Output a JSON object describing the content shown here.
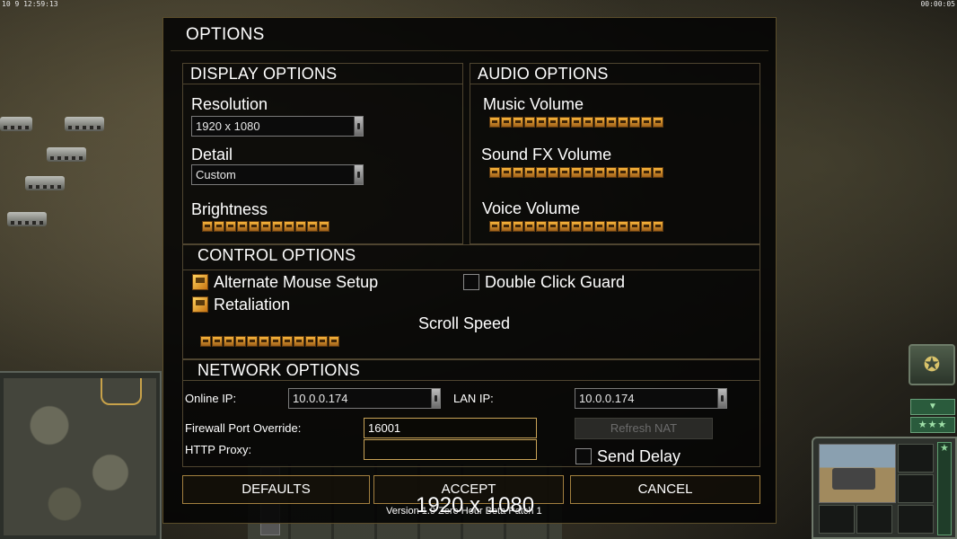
{
  "hud": {
    "top_left": "10 9 12:59:13",
    "top_right": "00:00:05"
  },
  "dialog": {
    "title": "OPTIONS",
    "display": {
      "header": "DISPLAY OPTIONS",
      "resolution_label": "Resolution",
      "resolution_value": "1920 x 1080",
      "detail_label": "Detail",
      "detail_value": "Custom",
      "brightness_label": "Brightness",
      "brightness_level": 1.0
    },
    "audio": {
      "header": "AUDIO OPTIONS",
      "music_label": "Music Volume",
      "music_level": 1.0,
      "sfx_label": "Sound FX Volume",
      "sfx_level": 1.0,
      "voice_label": "Voice Volume",
      "voice_level": 1.0
    },
    "control": {
      "header": "CONTROL OPTIONS",
      "alt_mouse_label": "Alternate Mouse Setup",
      "alt_mouse_checked": true,
      "double_click_label": "Double Click Guard",
      "double_click_checked": false,
      "retaliation_label": "Retaliation",
      "retaliation_checked": true,
      "scroll_speed_label": "Scroll Speed",
      "scroll_speed_level": 1.0
    },
    "network": {
      "header": "NETWORK OPTIONS",
      "online_ip_label": "Online IP:",
      "online_ip_value": "10.0.0.174",
      "lan_ip_label": "LAN IP:",
      "lan_ip_value": "10.0.0.174",
      "firewall_label": "Firewall Port Override:",
      "firewall_value": "16001",
      "http_proxy_label": "HTTP Proxy:",
      "http_proxy_value": "",
      "refresh_nat_label": "Refresh NAT",
      "send_delay_label": "Send Delay",
      "send_delay_checked": false
    },
    "buttons": {
      "defaults": "DEFAULTS",
      "accept": "ACCEPT",
      "cancel": "CANCEL"
    },
    "version": "Version 1.9 Zero Hour Beta Patch 1",
    "resolution_overlay": "1920 x 1080"
  },
  "colors": {
    "accent_gold": "#c9a357",
    "slider_orange": "#f7b33a",
    "panel_green": "#2a5b3c"
  }
}
